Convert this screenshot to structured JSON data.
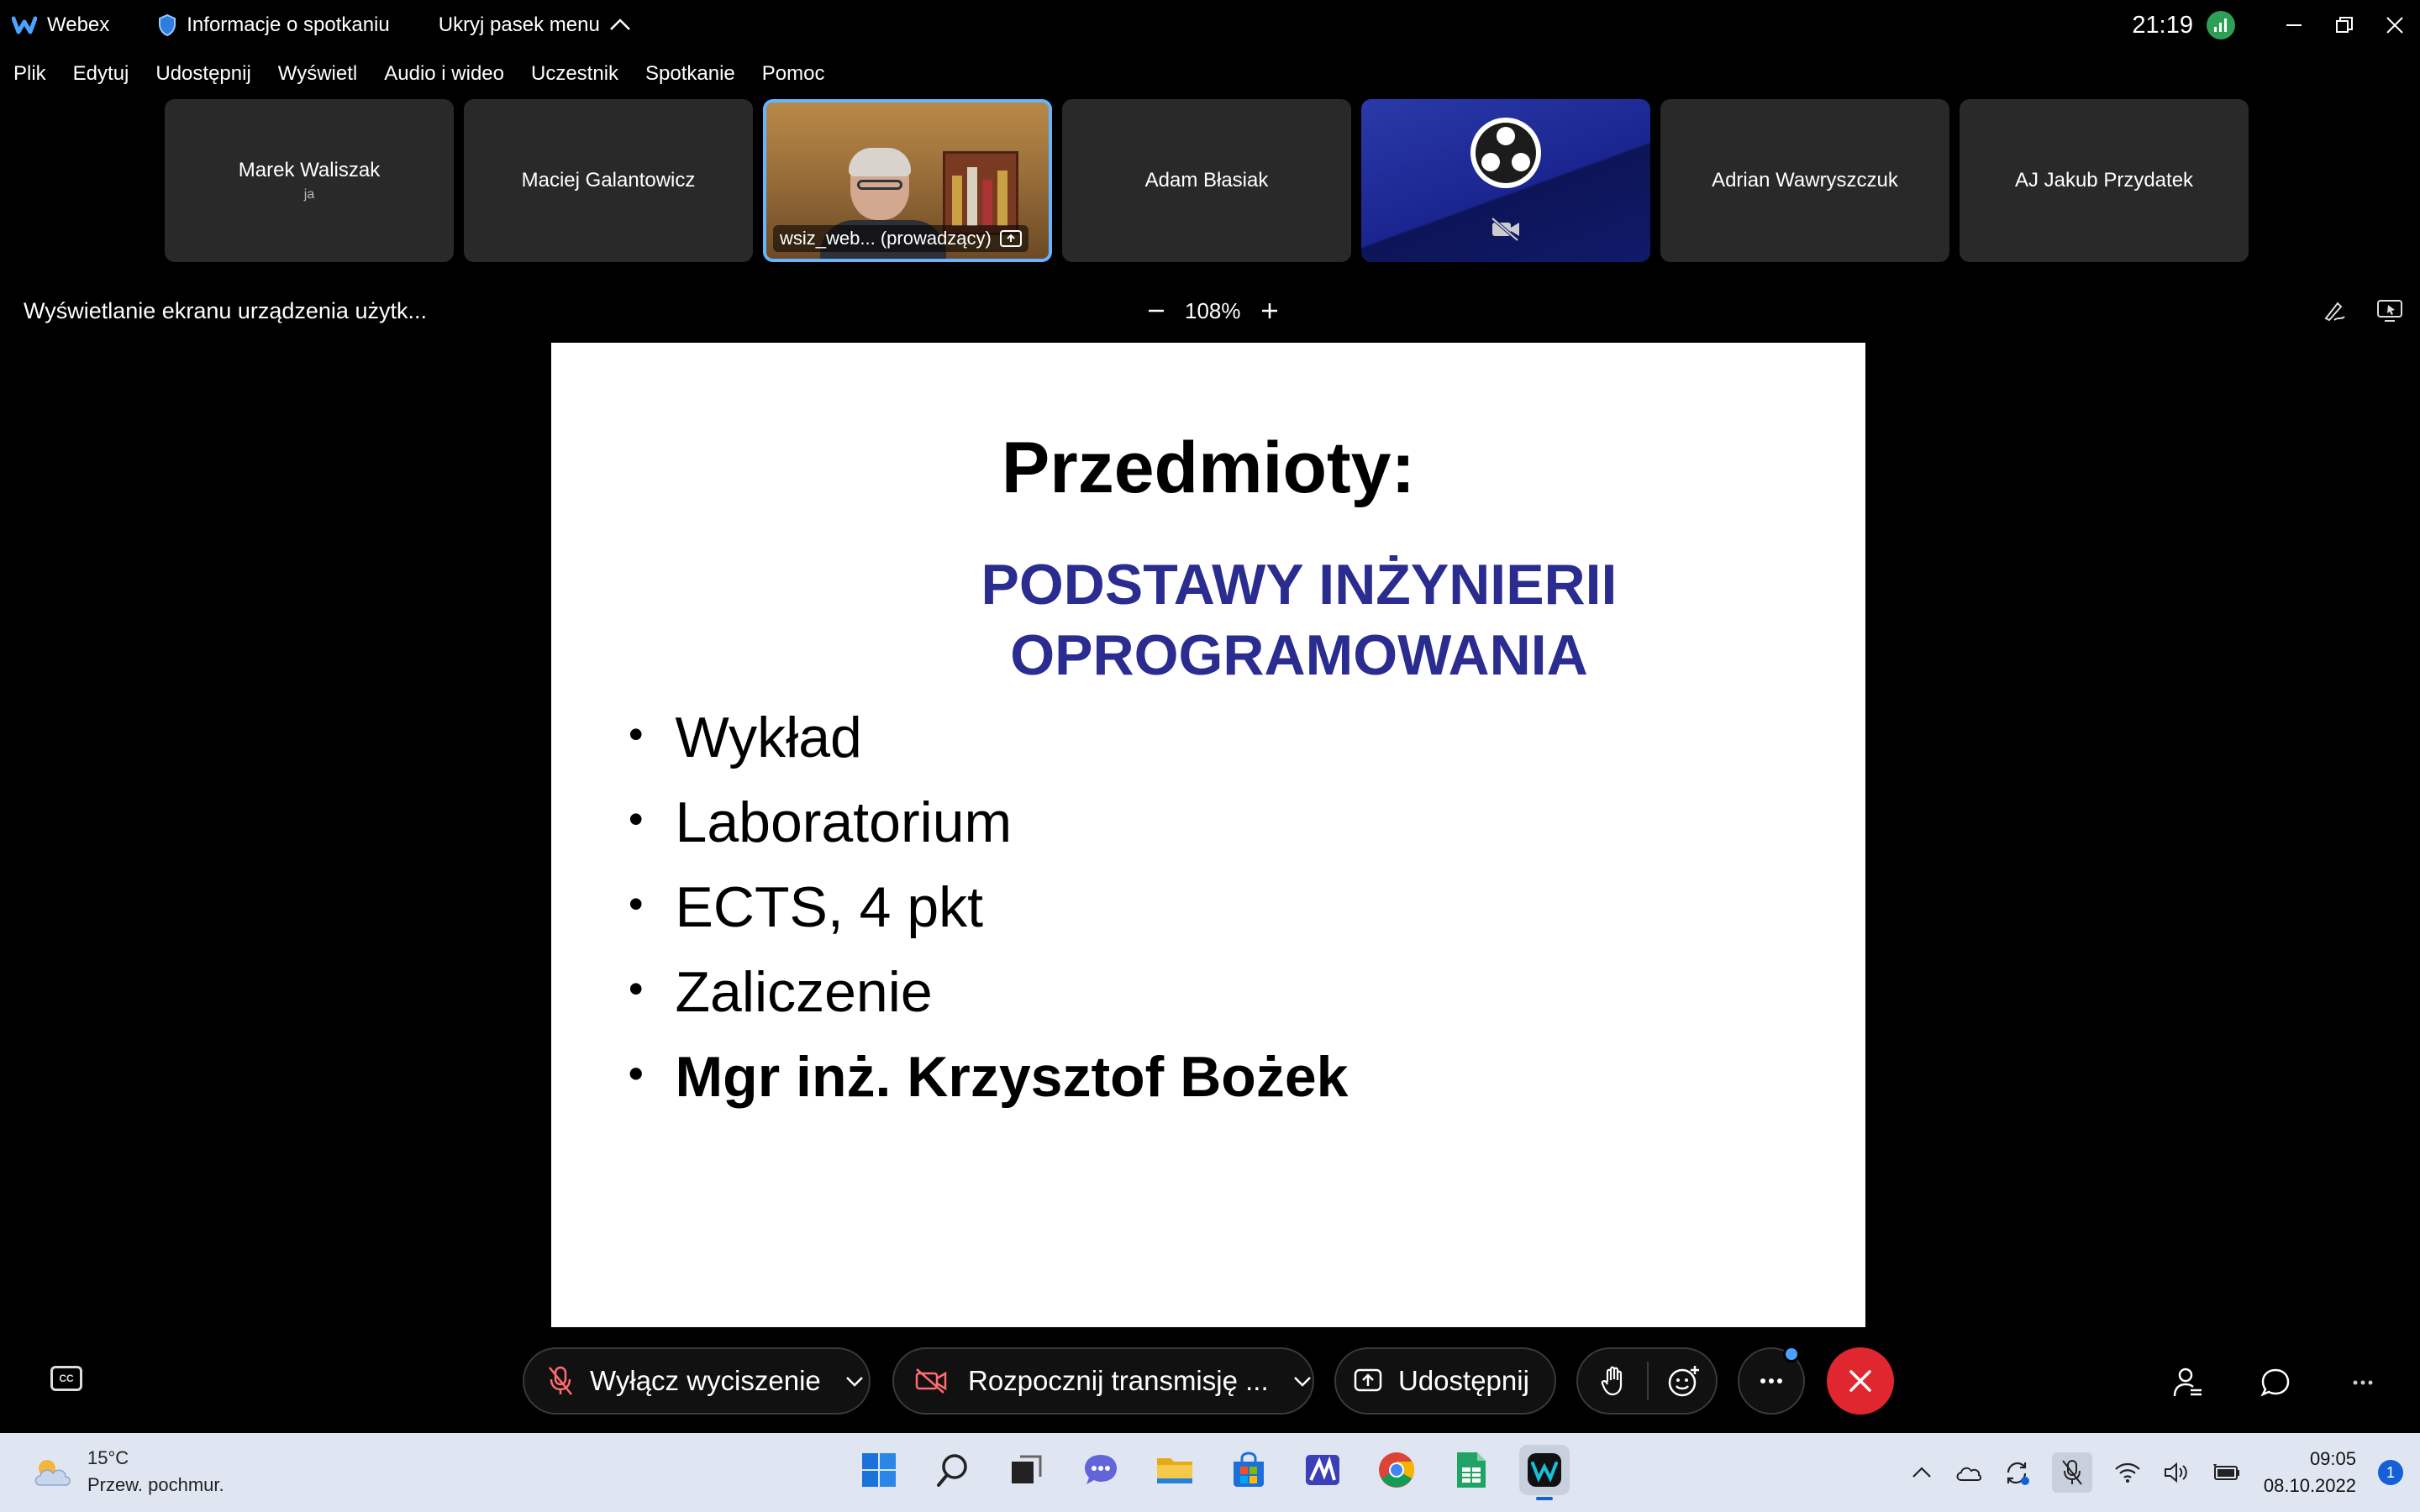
{
  "titlebar": {
    "app_name": "Webex",
    "meeting_info": "Informacje o spotkaniu",
    "hide_menu": "Ukryj pasek menu",
    "clock": "21:19"
  },
  "menu": [
    "Plik",
    "Edytuj",
    "Udostępnij",
    "Wyświetl",
    "Audio i wideo",
    "Uczestnik",
    "Spotkanie",
    "Pomoc"
  ],
  "participants": [
    {
      "name": "Marek Waliszak",
      "sub": "ja"
    },
    {
      "name": "Maciej Galantowicz"
    },
    {
      "name": "wsiz_web... (prowadzący)",
      "video": true
    },
    {
      "name": "Adam Błasiak"
    },
    {
      "name": "",
      "obs": true
    },
    {
      "name": "Adrian Wawryszczuk"
    },
    {
      "name": "AJ Jakub Przydatek"
    }
  ],
  "share": {
    "title": "Wyświetlanie ekranu urządzenia użytk...",
    "zoom": "108%"
  },
  "slide": {
    "title": "Przedmioty:",
    "subtitle_line1": "PODSTAWY INŻYNIERII",
    "subtitle_line2": "OPROGRAMOWANIA",
    "bullets": [
      "Wykład",
      "Laboratorium",
      "ECTS, 4 pkt",
      "Zaliczenie",
      "Mgr inż. Krzysztof Bożek"
    ]
  },
  "controls": {
    "unmute": "Wyłącz wyciszenie",
    "start_video": "Rozpocznij transmisję ...",
    "share": "Udostępnij"
  },
  "taskbar": {
    "temperature": "15°C",
    "weather": "Przew. pochmur.",
    "time": "09:05",
    "date": "08.10.2022",
    "notifications": "1"
  },
  "colors": {
    "slide_subtitle": "#2a2c8f",
    "active_tile_border": "#64b4ff",
    "end_call": "#e0262f"
  }
}
